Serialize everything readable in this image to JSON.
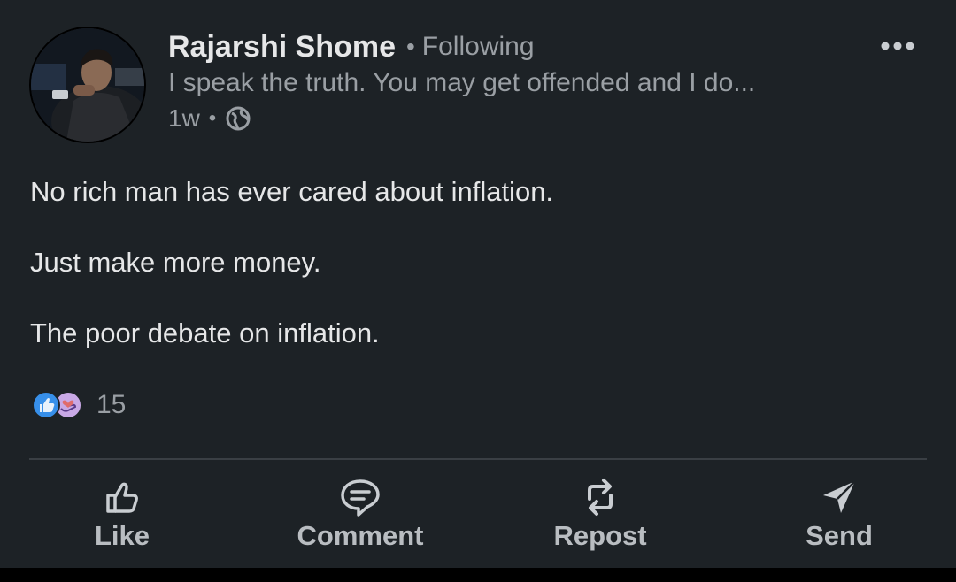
{
  "post": {
    "author": {
      "name": "Rajarshi Shome",
      "separator": "•",
      "follow_status": "Following",
      "headline": "I speak the truth. You may get offended and I do...",
      "time": "1w",
      "time_separator": "•",
      "visibility_icon": "globe-icon"
    },
    "more_icon": "more-horizontal-icon",
    "body": [
      "No rich man has ever cared about inflation.",
      "Just make more money.",
      "The poor debate on inflation."
    ],
    "reactions": {
      "icons": [
        "like-reaction-icon",
        "support-reaction-icon"
      ],
      "count": "15"
    },
    "actions": [
      {
        "label": "Like",
        "icon": "thumbs-up-icon"
      },
      {
        "label": "Comment",
        "icon": "comment-icon"
      },
      {
        "label": "Repost",
        "icon": "repost-icon"
      },
      {
        "label": "Send",
        "icon": "send-icon"
      }
    ]
  },
  "colors": {
    "background": "#1d2226",
    "primary_text": "#e6e7e8",
    "secondary_text": "#9a9fa4",
    "action_text": "#b9bdc1",
    "divider": "#3a3f44",
    "like_blue": "#378fe9",
    "support_purple": "#c9a9e6"
  }
}
